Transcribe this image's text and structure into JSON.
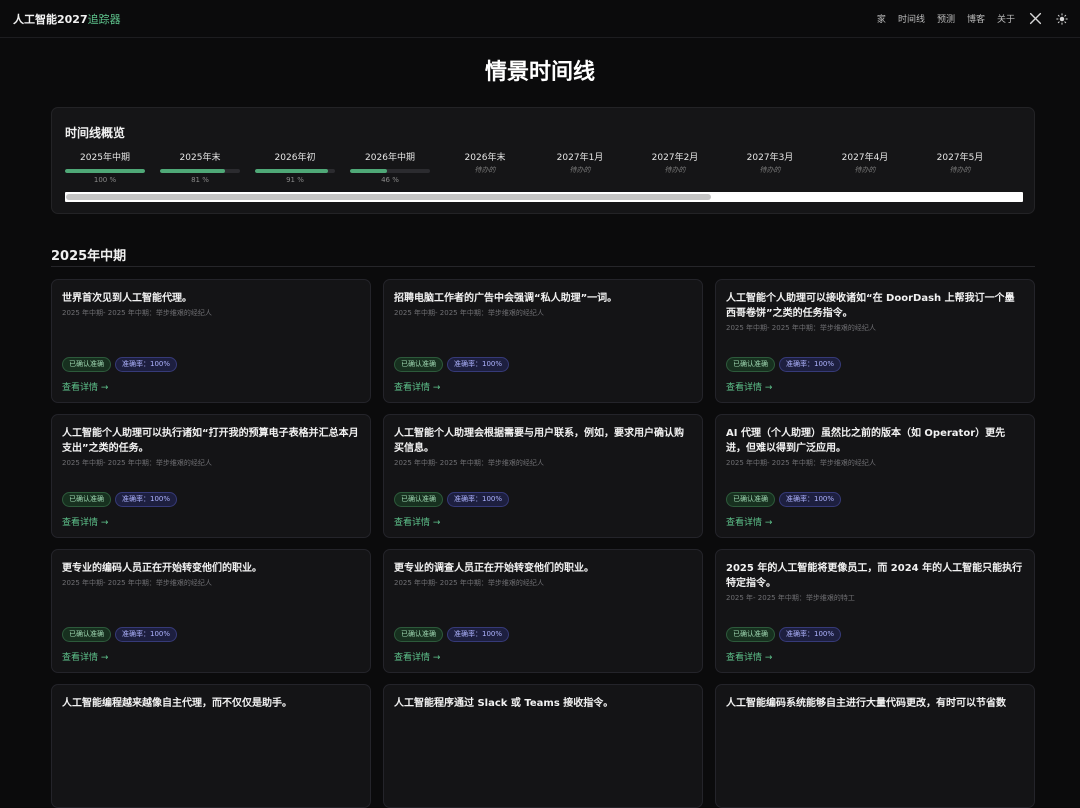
{
  "nav": {
    "brand_main": "人工智能2027",
    "brand_accent": "追踪器",
    "links": [
      "家",
      "时间线",
      "预测",
      "博客",
      "关于"
    ],
    "icons": [
      "x-logo-icon",
      "sun-icon"
    ]
  },
  "page": {
    "title": "情景时间线"
  },
  "overview": {
    "title": "时间线概览",
    "milestones": [
      {
        "label": "2025年中期",
        "status": "100 %",
        "progress": 1.0,
        "pending": false
      },
      {
        "label": "2025年末",
        "status": "81 %",
        "progress": 0.81,
        "pending": false
      },
      {
        "label": "2026年初",
        "status": "91 %",
        "progress": 0.91,
        "pending": false
      },
      {
        "label": "2026年中期",
        "status": "46 %",
        "progress": 0.46,
        "pending": false
      },
      {
        "label": "2026年末",
        "status": "待办的",
        "pending": true
      },
      {
        "label": "2027年1月",
        "status": "待办的",
        "pending": true
      },
      {
        "label": "2027年2月",
        "status": "待办的",
        "pending": true
      },
      {
        "label": "2027年3月",
        "status": "待办的",
        "pending": true
      },
      {
        "label": "2027年4月",
        "status": "待办的",
        "pending": true
      },
      {
        "label": "2027年5月",
        "status": "待办的",
        "pending": true
      }
    ]
  },
  "section": {
    "title": "2025年中期"
  },
  "cards": [
    {
      "title": "世界首次见到人工智能代理。",
      "meta": "2025 年中期- 2025 年中期：举步维艰的经纪人",
      "status": "已确认准确",
      "accuracy": "准确率：100%",
      "link": "查看详情 →"
    },
    {
      "title": "招聘电脑工作者的广告中会强调“私人助理”一词。",
      "meta": "2025 年中期- 2025 年中期：举步维艰的经纪人",
      "status": "已确认准确",
      "accuracy": "准确率：100%",
      "link": "查看详情 →"
    },
    {
      "title": "人工智能个人助理可以接收诸如“在 DoorDash 上帮我订一个墨西哥卷饼”之类的任务指令。",
      "meta": "2025 年中期- 2025 年中期：举步维艰的经纪人",
      "status": "已确认准确",
      "accuracy": "准确率：100%",
      "link": "查看详情 →"
    },
    {
      "title": "人工智能个人助理可以执行诸如“打开我的预算电子表格并汇总本月支出”之类的任务。",
      "meta": "2025 年中期- 2025 年中期：举步维艰的经纪人",
      "status": "已确认准确",
      "accuracy": "准确率：100%",
      "link": "查看详情 →"
    },
    {
      "title": "人工智能个人助理会根据需要与用户联系，例如，要求用户确认购买信息。",
      "meta": "2025 年中期- 2025 年中期：举步维艰的经纪人",
      "status": "已确认准确",
      "accuracy": "准确率：100%",
      "link": "查看详情 →"
    },
    {
      "title": "AI 代理（个人助理）虽然比之前的版本（如 Operator）更先进，但难以得到广泛应用。",
      "meta": "2025 年中期- 2025 年中期：举步维艰的经纪人",
      "status": "已确认准确",
      "accuracy": "准确率：100%",
      "link": "查看详情 →"
    },
    {
      "title": "更专业的编码人员正在开始转变他们的职业。",
      "meta": "2025 年中期- 2025 年中期：举步维艰的经纪人",
      "status": "已确认准确",
      "accuracy": "准确率：100%",
      "link": "查看详情 →"
    },
    {
      "title": "更专业的调查人员正在开始转变他们的职业。",
      "meta": "2025 年中期- 2025 年中期：举步维艰的经纪人",
      "status": "已确认准确",
      "accuracy": "准确率：100%",
      "link": "查看详情 →"
    },
    {
      "title": "2025 年的人工智能将更像员工，而 2024 年的人工智能只能执行特定指令。",
      "meta": "2025 年- 2025 年中期：举步维艰的特工",
      "status": "已确认准确",
      "accuracy": "准确率：100%",
      "link": "查看详情 →"
    },
    {
      "title": "人工智能编程越来越像自主代理，而不仅仅是助手。",
      "meta": "",
      "status": "",
      "accuracy": "",
      "link": ""
    },
    {
      "title": "人工智能程序通过 Slack 或 Teams 接收指令。",
      "meta": "",
      "status": "",
      "accuracy": "",
      "link": ""
    },
    {
      "title": "人工智能编码系统能够自主进行大量代码更改，有时可以节省数",
      "meta": "",
      "status": "",
      "accuracy": "",
      "link": ""
    }
  ]
}
